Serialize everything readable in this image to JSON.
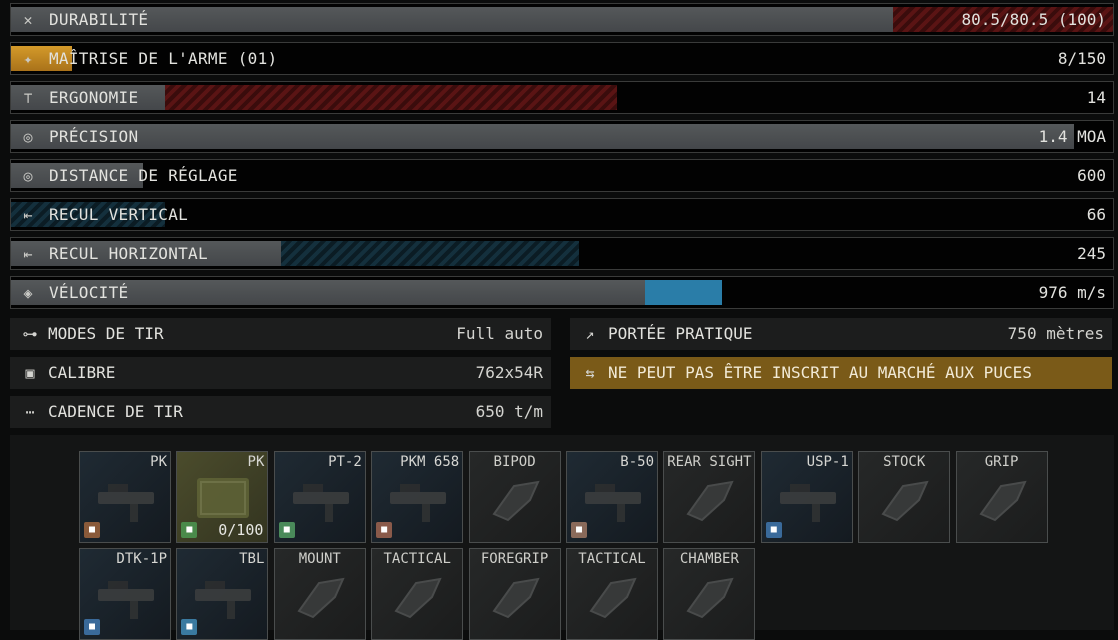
{
  "stats": [
    {
      "label": "DURABILITÉ",
      "value": "80.5/80.5 (100)",
      "icon": "wrench-icon",
      "base": 0.8,
      "neg_start": 0.8,
      "neg_end": 1.0,
      "neg_color": "red"
    },
    {
      "label": "MAÎTRISE DE L'ARME (01)",
      "value": "8/150",
      "icon": "mastery-icon",
      "gold": 0.055
    },
    {
      "label": "ERGONOMIE",
      "value": "14",
      "icon": "ergonomics-icon",
      "base": 0.14,
      "neg_start": 0.14,
      "neg_end": 0.55,
      "neg_color": "red"
    },
    {
      "label": "PRÉCISION",
      "value": "1.4 MOA",
      "icon": "crosshair-icon",
      "base": 0.965
    },
    {
      "label": "DISTANCE DE RÉGLAGE",
      "value": "600",
      "icon": "crosshair-icon",
      "base": 0.12
    },
    {
      "label": "RECUL VERTICAL",
      "value": "66",
      "icon": "recoil-icon",
      "base": 0.0,
      "neg_start": 0.0,
      "neg_end": 0.14,
      "neg_color": "blue"
    },
    {
      "label": "RECUL HORIZONTAL",
      "value": "245",
      "icon": "recoil-icon",
      "base": 0.245,
      "neg_start": 0.245,
      "neg_end": 0.515,
      "neg_color": "blue"
    },
    {
      "label": "VÉLOCITÉ",
      "value": "976 m/s",
      "icon": "velocity-icon",
      "base": 0.575,
      "pos_start": 0.575,
      "pos_end": 0.645
    }
  ],
  "info_left": [
    {
      "label": "MODES DE TIR",
      "value": "Full auto",
      "icon": "fire-mode-icon"
    },
    {
      "label": "CALIBRE",
      "value": "762x54R",
      "icon": "caliber-icon"
    },
    {
      "label": "CADENCE DE TIR",
      "value": "650 t/m",
      "icon": "rate-of-fire-icon"
    }
  ],
  "info_right": [
    {
      "label": "PORTÉE PRATIQUE",
      "value": "750 mètres",
      "icon": "range-icon"
    },
    {
      "label": "NE PEUT PAS ÊTRE INSCRIT AU MARCHÉ AUX PUCES",
      "value": "",
      "icon": "no-flea-icon",
      "warning": true
    }
  ],
  "slots_row1": [
    {
      "title": "PK",
      "kind": "mod",
      "tag_color": "#8a5a3a"
    },
    {
      "title": "PK",
      "kind": "mag",
      "tag_color": "#4a8a4a",
      "count": "0/100"
    },
    {
      "title": "PT-2",
      "kind": "mod",
      "tag_color": "#4a8a5a"
    },
    {
      "title": "PKM 658",
      "kind": "mod",
      "tag_color": "#8a5a4a"
    },
    {
      "title": "BIPOD",
      "kind": "empty"
    },
    {
      "title": "B-50",
      "kind": "mod",
      "tag_color": "#8a6a5a"
    },
    {
      "title": "REAR SIGHT",
      "kind": "empty"
    },
    {
      "title": "USP-1",
      "kind": "mod",
      "tag_color": "#3a6a9a"
    },
    {
      "title": "STOCK",
      "kind": "empty"
    },
    {
      "title": "GRIP",
      "kind": "empty"
    }
  ],
  "slots_row2": [
    {
      "title": "DTK-1P",
      "kind": "mod",
      "tag_color": "#3a6a9a"
    },
    {
      "title": "TBL",
      "kind": "mod",
      "tag_color": "#3a7aa0"
    },
    {
      "title": "MOUNT",
      "kind": "empty"
    },
    {
      "title": "TACTICAL",
      "kind": "empty"
    },
    {
      "title": "FOREGRIP",
      "kind": "empty"
    },
    {
      "title": "TACTICAL",
      "kind": "empty"
    },
    {
      "title": "CHAMBER",
      "kind": "empty"
    }
  ]
}
